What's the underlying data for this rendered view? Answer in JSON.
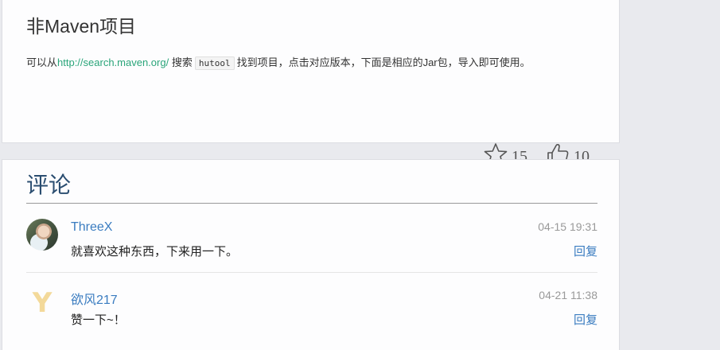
{
  "section": {
    "title": "非Maven项目",
    "desc_prefix": "可以从",
    "desc_link": "http://search.maven.org/",
    "desc_mid": " 搜索",
    "desc_code": "hutool",
    "desc_suffix": "找到项目，点击对应版本，下面是相应的Jar包，导入即可使用。"
  },
  "actions": {
    "star_icon": "star-outline",
    "star_count": "15",
    "like_icon": "thumbs-up-outline",
    "like_count": "10"
  },
  "comments": {
    "title": "评论",
    "items": [
      {
        "author": "ThreeX",
        "time": "04-15 19:31",
        "text": "就喜欢这种东西，下来用一下。",
        "reply": "回复",
        "avatar": "photo"
      },
      {
        "author": "欲风217",
        "time": "04-21 11:38",
        "text": "赞一下~！",
        "reply": "回复",
        "avatar": "Y"
      }
    ]
  }
}
